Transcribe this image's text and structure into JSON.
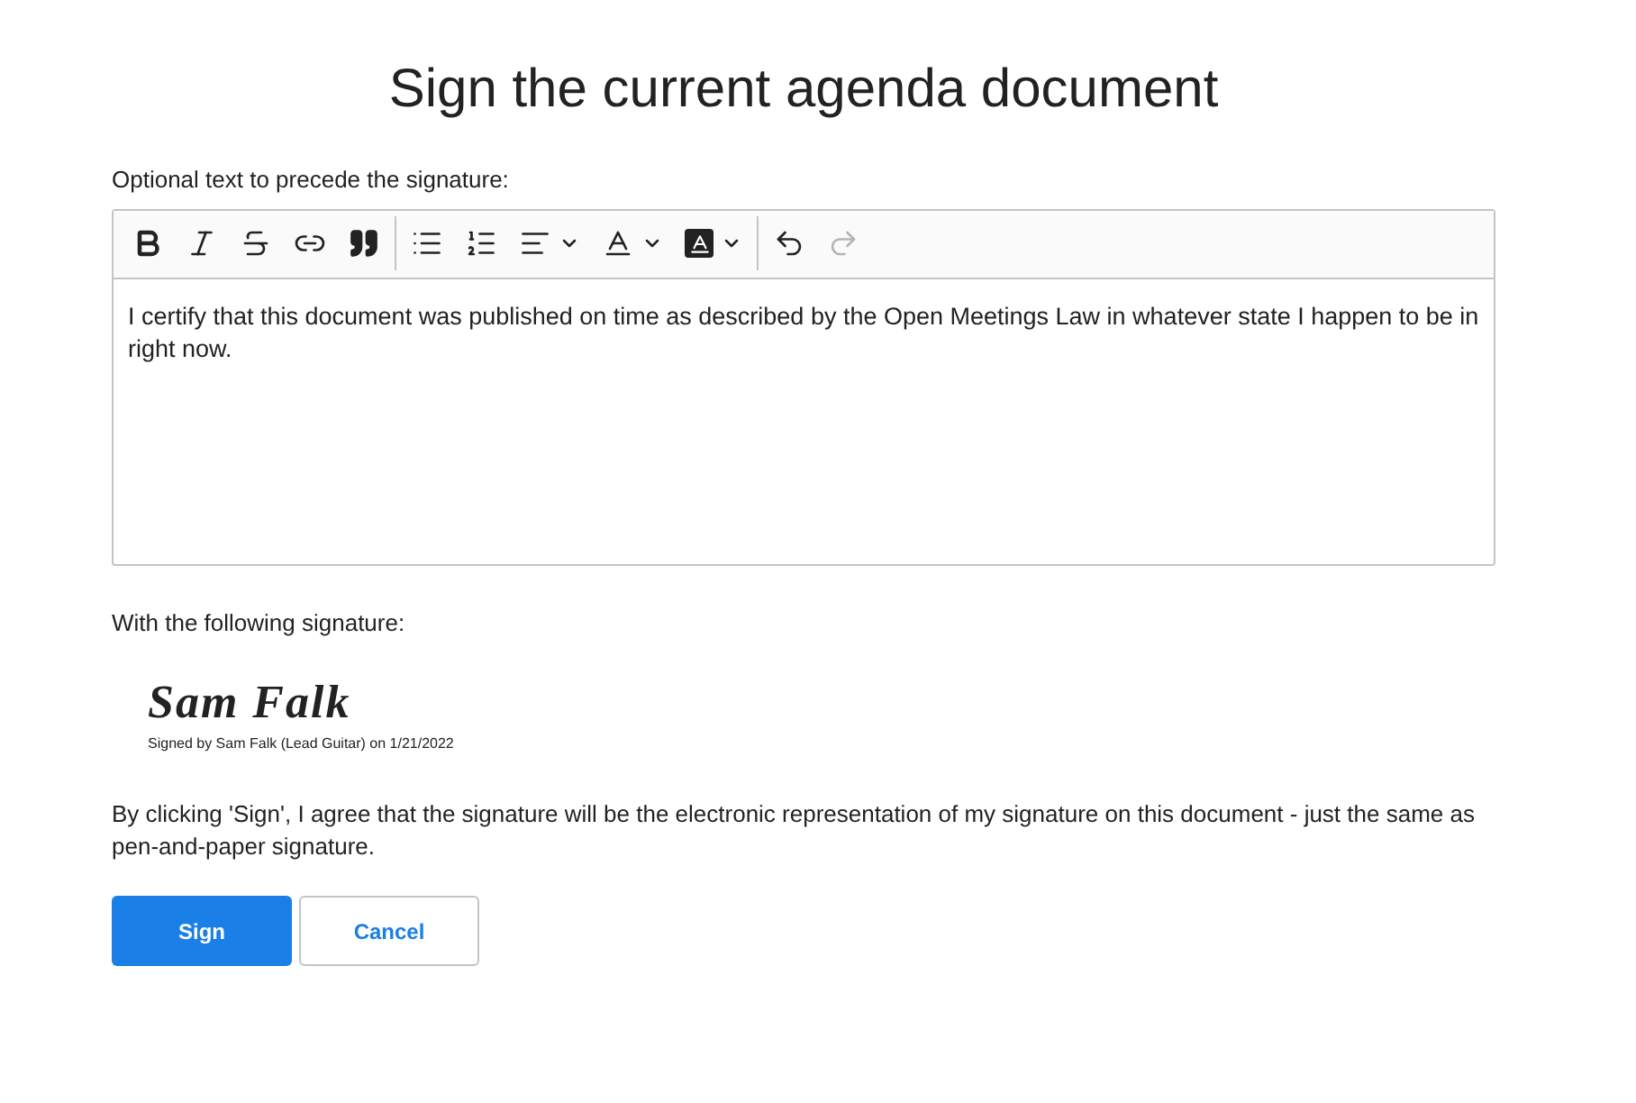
{
  "title": "Sign the current agenda document",
  "editor_label": "Optional text to precede the signature:",
  "toolbar": [
    [
      {
        "kind": "bold",
        "dropdown": false,
        "disabled": false
      },
      {
        "kind": "italic",
        "dropdown": false,
        "disabled": false
      },
      {
        "kind": "strikethrough",
        "dropdown": false,
        "disabled": false
      },
      {
        "kind": "link",
        "dropdown": false,
        "disabled": false
      },
      {
        "kind": "quote",
        "dropdown": false,
        "disabled": false
      }
    ],
    [
      {
        "kind": "bullet_list",
        "dropdown": false,
        "disabled": false
      },
      {
        "kind": "numbered_list",
        "dropdown": false,
        "disabled": false
      },
      {
        "kind": "align",
        "dropdown": true,
        "disabled": false
      },
      {
        "kind": "text_color",
        "dropdown": true,
        "disabled": false
      },
      {
        "kind": "highlight",
        "dropdown": true,
        "disabled": false
      }
    ],
    [
      {
        "kind": "undo",
        "dropdown": false,
        "disabled": false
      },
      {
        "kind": "redo",
        "dropdown": false,
        "disabled": true
      }
    ]
  ],
  "editor_text": "I certify that this document was published on time as described by the Open Meetings Law in whatever state I happen to be in right now.",
  "signature_label": "With the following signature:",
  "signature": {
    "name": "Sam Falk",
    "caption": "Signed by Sam Falk (Lead Guitar) on 1/21/2022"
  },
  "agreement": "By clicking 'Sign', I agree that the signature will be the electronic representation of my signature on this document - just the same as pen-and-paper signature.",
  "buttons": [
    {
      "label": "Sign",
      "kind": "primary"
    },
    {
      "label": "Cancel",
      "kind": "secondary"
    }
  ]
}
